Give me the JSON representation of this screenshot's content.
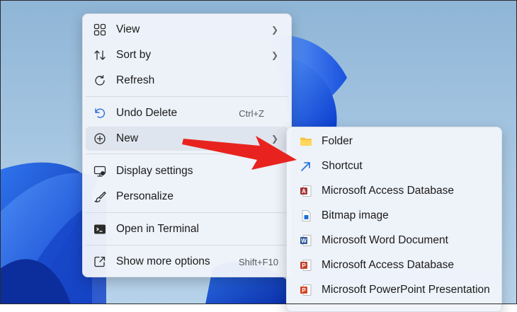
{
  "main_menu": {
    "items": [
      {
        "label": "View",
        "icon": "grid-view-icon",
        "shortcut": "",
        "submenu": true
      },
      {
        "label": "Sort by",
        "icon": "sort-arrows-icon",
        "shortcut": "",
        "submenu": true
      },
      {
        "label": "Refresh",
        "icon": "refresh-icon",
        "shortcut": "",
        "submenu": false
      },
      {
        "label": "Undo Delete",
        "icon": "undo-icon",
        "shortcut": "Ctrl+Z",
        "submenu": false
      },
      {
        "label": "New",
        "icon": "plus-circle-icon",
        "shortcut": "",
        "submenu": true
      },
      {
        "label": "Display settings",
        "icon": "monitor-icon",
        "shortcut": "",
        "submenu": false
      },
      {
        "label": "Personalize",
        "icon": "brush-icon",
        "shortcut": "",
        "submenu": false
      },
      {
        "label": "Open in Terminal",
        "icon": "terminal-icon",
        "shortcut": "",
        "submenu": false
      },
      {
        "label": "Show more options",
        "icon": "share-window-icon",
        "shortcut": "Shift+F10",
        "submenu": false
      }
    ]
  },
  "new_submenu": {
    "items": [
      {
        "label": "Folder",
        "icon": "folder-icon"
      },
      {
        "label": "Shortcut",
        "icon": "shortcut-arrow-icon"
      },
      {
        "label": "Microsoft Access Database",
        "icon": "access-icon"
      },
      {
        "label": "Bitmap image",
        "icon": "bitmap-icon"
      },
      {
        "label": "Microsoft Word Document",
        "icon": "word-icon"
      },
      {
        "label": "Microsoft Access Database",
        "icon": "access-icon"
      },
      {
        "label": "Microsoft PowerPoint Presentation",
        "icon": "powerpoint-icon"
      }
    ]
  },
  "colors": {
    "accent": "#e8231f",
    "wallpaper": "#1e5de0"
  }
}
